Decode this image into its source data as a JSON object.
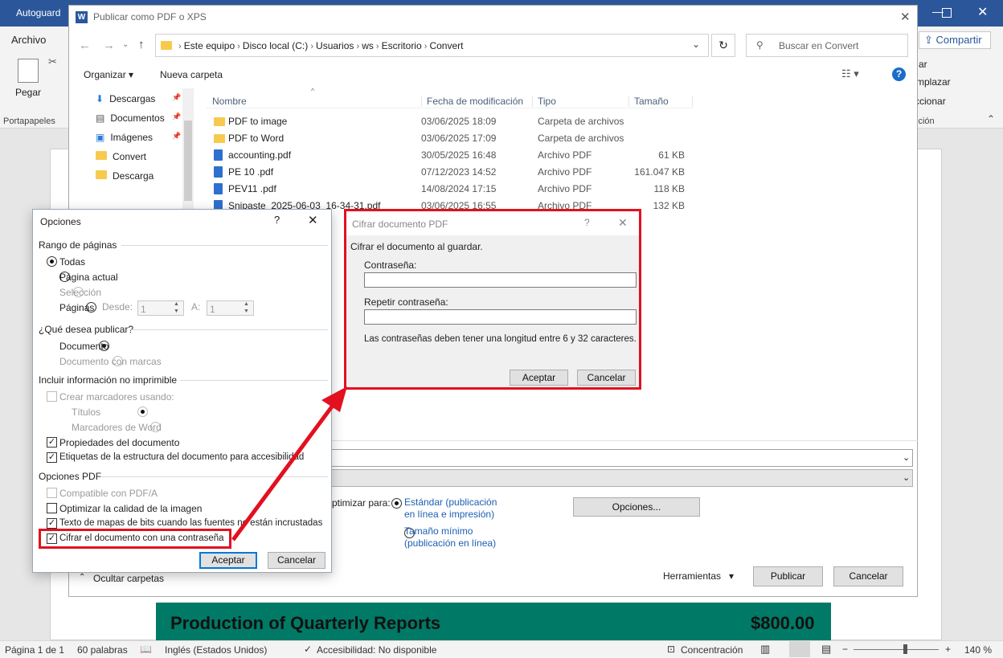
{
  "word": {
    "title_left": "Autoguard",
    "tab_archivo": "Archivo",
    "share": "Compartir",
    "paste": "Pegar",
    "clipboard_group": "Portapapeles",
    "edicion_group": "ición",
    "rib_r1": "ar",
    "rib_r2": "mplazar",
    "rib_r3": "ccionar",
    "heading": "Production of Quarterly Reports",
    "amount": "$800.00",
    "status": {
      "page": "Página 1 de 1",
      "words": "60 palabras",
      "lang": "Inglés (Estados Unidos)",
      "access": "Accesibilidad: No disponible",
      "focus": "Concentración",
      "zoom": "140 %"
    }
  },
  "publish": {
    "title": "Publicar como PDF o XPS",
    "crumbs": [
      "Este equipo",
      "Disco local (C:)",
      "Usuarios",
      "ws",
      "Escritorio",
      "Convert"
    ],
    "search_placeholder": "Buscar en Convert",
    "organize": "Organizar",
    "new_folder": "Nueva carpeta",
    "nav": [
      "Descargas",
      "Documentos",
      "Imágenes",
      "Convert",
      "Descarga"
    ],
    "cols": {
      "name": "Nombre",
      "date": "Fecha de modificación",
      "type": "Tipo",
      "size": "Tamaño"
    },
    "files": [
      {
        "name": "PDF to image",
        "date": "03/06/2025 18:09",
        "type": "Carpeta de archivos",
        "size": "",
        "kind": "folder"
      },
      {
        "name": "PDF to Word",
        "date": "03/06/2025 17:09",
        "type": "Carpeta de archivos",
        "size": "",
        "kind": "folder"
      },
      {
        "name": "accounting.pdf",
        "date": "30/05/2025 16:48",
        "type": "Archivo PDF",
        "size": "61 KB",
        "kind": "pdf"
      },
      {
        "name": "PE 10            .pdf",
        "date": "07/12/2023 14:52",
        "type": "Archivo PDF",
        "size": "161.047 KB",
        "kind": "pdf"
      },
      {
        "name": "PEV11             .pdf",
        "date": "14/08/2024 17:15",
        "type": "Archivo PDF",
        "size": "118 KB",
        "kind": "pdf"
      },
      {
        "name": "Snipaste_2025-06-03_16-34-31.pdf",
        "date": "03/06/2025 16:55",
        "type": "Archivo PDF",
        "size": "132 KB",
        "kind": "pdf"
      }
    ],
    "optimize_label": "ptimizar para:",
    "opt_standard": "Estándar (publicación en línea e impresión)",
    "opt_min": "Tamaño mínimo (publicación en línea)",
    "options_btn": "Opciones...",
    "hide_folders": "Ocultar carpetas",
    "tools": "Herramientas",
    "publish_btn": "Publicar",
    "cancel_btn": "Cancelar"
  },
  "options": {
    "title": "Opciones",
    "range_title": "Rango de páginas",
    "all": "Todas",
    "current": "Página actual",
    "selection": "Selección",
    "pages": "Páginas",
    "from": "Desde:",
    "to": "A:",
    "from_val": "1",
    "to_val": "1",
    "publish_title": "¿Qué desea publicar?",
    "document": "Documento",
    "doc_markup": "Documento con marcas",
    "nonprint_title": "Incluir información no imprimible",
    "bookmarks": "Crear marcadores usando:",
    "headings": "Títulos",
    "word_bm": "Marcadores de Word",
    "props": "Propiedades del documento",
    "tags": "Etiquetas de la estructura del documento para accesibilidad",
    "pdf_title": "Opciones PDF",
    "pdfa": "Compatible con PDF/A",
    "optimize_img": "Optimizar la calidad de la imagen",
    "bitmap": "Texto de mapas de bits cuando las fuentes no están incrustadas",
    "encrypt": "Cifrar el documento con una contraseña",
    "ok": "Aceptar",
    "cancel": "Cancelar"
  },
  "encrypt": {
    "title": "Cifrar documento PDF",
    "intro": "Cifrar el documento al guardar.",
    "pwd": "Contraseña:",
    "repeat": "Repetir contraseña:",
    "hint": "Las contraseñas deben tener una longitud entre 6 y 32 caracteres.",
    "ok": "Aceptar",
    "cancel": "Cancelar"
  },
  "colors": {
    "word_blue": "#2b579a",
    "teal": "#007a66",
    "highlight": "#e3101f"
  }
}
